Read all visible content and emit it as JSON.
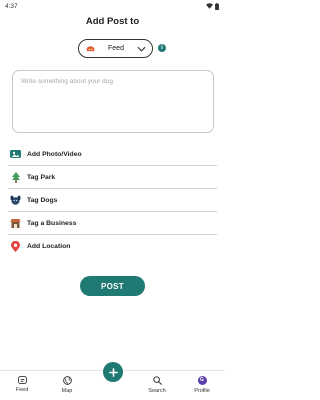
{
  "status_bar": {
    "time": "4:37"
  },
  "header": {
    "title": "Add Post to"
  },
  "feed_selector": {
    "value": "Feed"
  },
  "info": {
    "icon": "info-icon",
    "glyph": "i"
  },
  "composer": {
    "placeholder": "Write something about your dog",
    "value": ""
  },
  "options": [
    {
      "label": "Add Photo/Video",
      "icon": "photo-video-icon"
    },
    {
      "label": "Tag Park",
      "icon": "park-tree-icon"
    },
    {
      "label": "Tag Dogs",
      "icon": "dog-icon"
    },
    {
      "label": "Tag a Business",
      "icon": "business-icon"
    },
    {
      "label": "Add Location",
      "icon": "location-pin-icon"
    }
  ],
  "post_button": {
    "label": "POST"
  },
  "bottom_nav": {
    "feed": "Feed",
    "map": "Map",
    "search": "Search",
    "profile": "Profile",
    "avatar_initial": "G"
  },
  "colors": {
    "accent": "#1f7a74",
    "avatar": "#5b3fa8",
    "location_pin": "#e04646"
  }
}
